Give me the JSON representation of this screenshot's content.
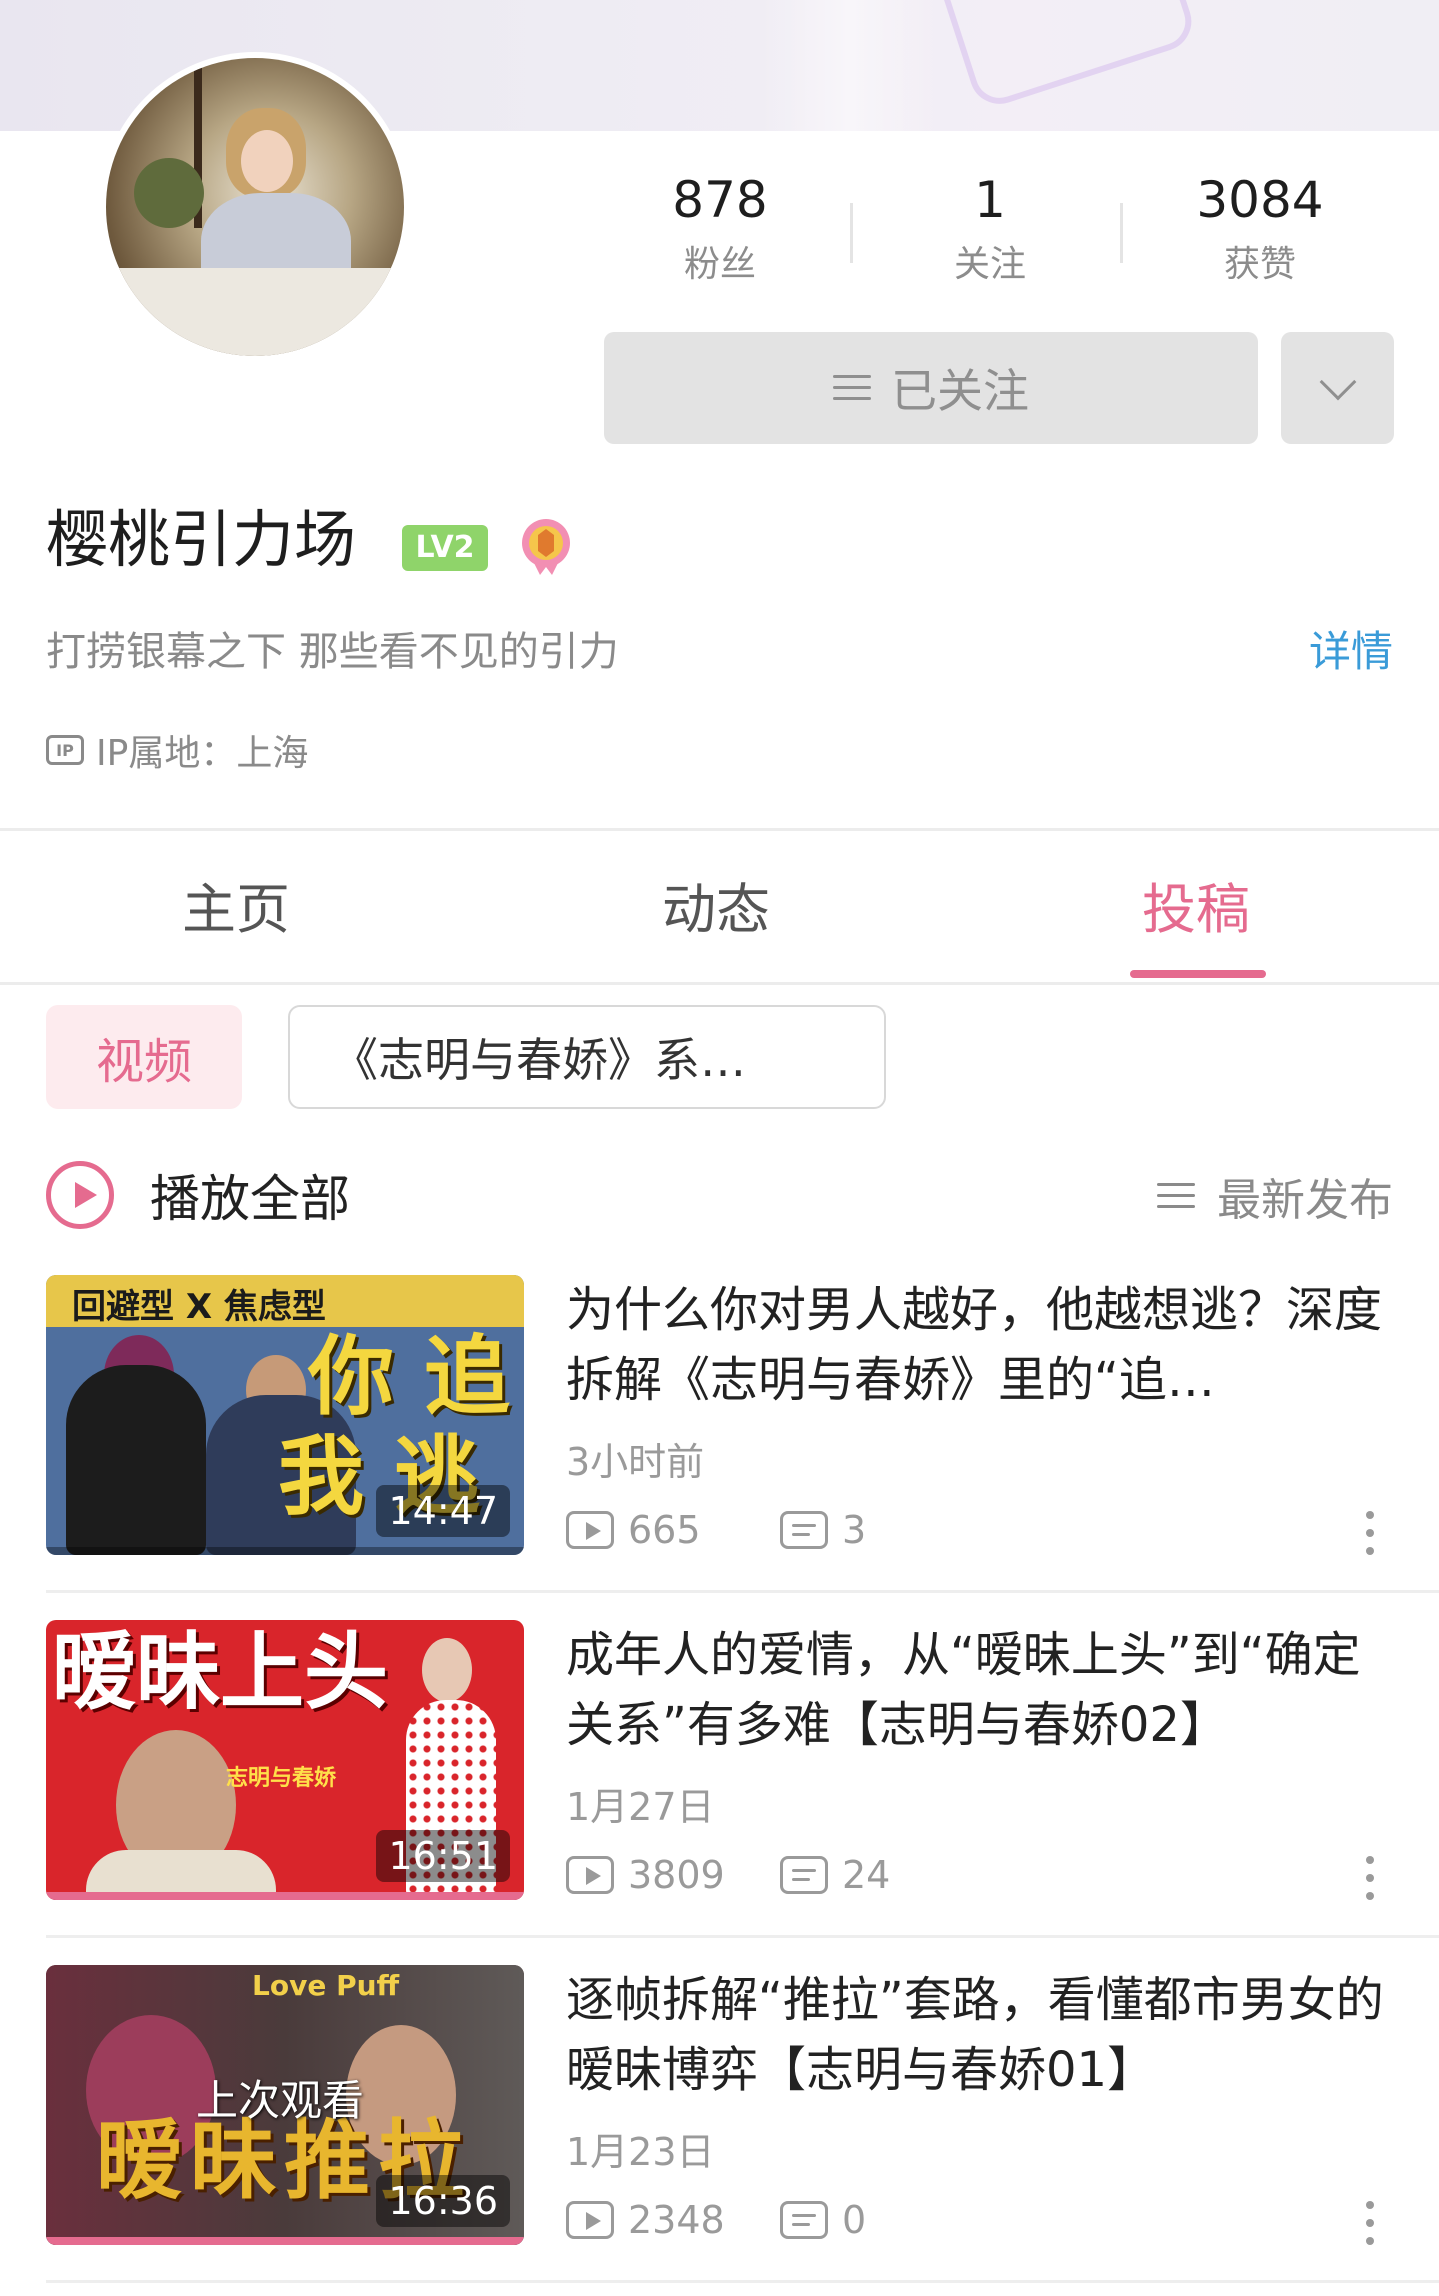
{
  "profile": {
    "name": "樱桃引力场",
    "level": "LV2",
    "bio": "打捞银幕之下 那些看不见的引力",
    "detail_label": "详情",
    "ip_label": "IP属地：上海",
    "ip_icon": "ip-icon"
  },
  "stats": [
    {
      "value": "878",
      "label": "粉丝"
    },
    {
      "value": "1",
      "label": "关注"
    },
    {
      "value": "3084",
      "label": "获赞"
    }
  ],
  "follow_button": {
    "label": "已关注",
    "icon": "menu-icon"
  },
  "tabs": [
    {
      "label": "主页",
      "active": false
    },
    {
      "label": "动态",
      "active": false
    },
    {
      "label": "投稿",
      "active": true
    }
  ],
  "filters": {
    "video_chip": "视频",
    "series_chip": "《志明与春娇》系…"
  },
  "toolbar": {
    "play_all": "播放全部",
    "sort": "最新发布"
  },
  "videos": [
    {
      "title": "为什么你对男人越好，他越想逃？深度拆解《志明与春娇》里的“追…",
      "time": "3小时前",
      "views": "665",
      "comments": "3",
      "duration": "14:47",
      "thumb": {
        "band": "回避型 X 焦虑型",
        "line1": "你 追",
        "line2": "我 逃"
      },
      "progress": 0
    },
    {
      "title": "成年人的爱情，从“暧昧上头”到“确定关系”有多难【志明与春娇02】",
      "time": "1月27日",
      "views": "3809",
      "comments": "24",
      "duration": "16:51",
      "thumb": {
        "big": "暧昧上头",
        "logo": "志明与春娇"
      },
      "progress": 1.0
    },
    {
      "title": "逐帧拆解“推拉”套路，看懂都市男女的暧昧博弈【志明与春娇01】",
      "time": "1月23日",
      "views": "2348",
      "comments": "0",
      "duration": "16:36",
      "thumb": {
        "big": "暧昧推拉",
        "logo": "Love Puff",
        "overlay": "上次观看"
      },
      "progress": 1.0
    }
  ],
  "colors": {
    "accent": "#e56b8f",
    "link": "#3a9bd8",
    "level_badge": "#8fd46a"
  }
}
